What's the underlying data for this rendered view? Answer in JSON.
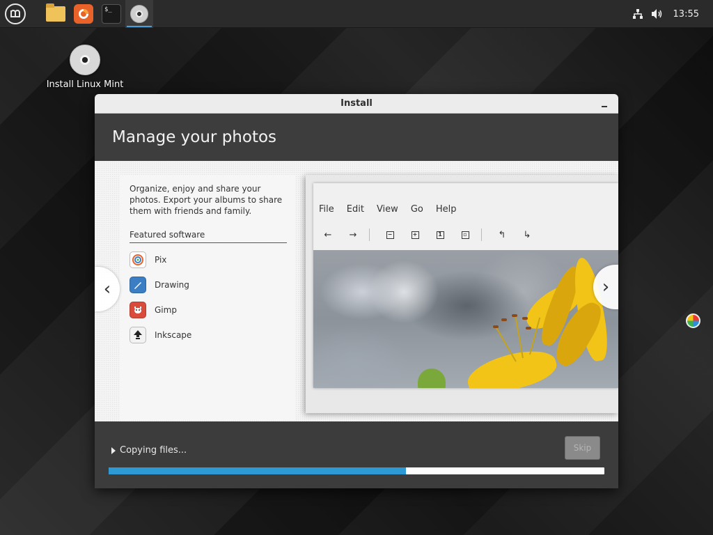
{
  "panel": {
    "launchers": [
      {
        "name": "mint-menu",
        "icon": "mint-logo-icon"
      },
      {
        "name": "files",
        "icon": "folder-icon"
      },
      {
        "name": "firefox",
        "icon": "firefox-icon"
      },
      {
        "name": "terminal",
        "icon": "terminal-icon",
        "glyph": "$_"
      },
      {
        "name": "installer",
        "icon": "disc-icon",
        "active": true
      }
    ],
    "tray": {
      "network_icon": "network-icon",
      "volume_icon": "volume-icon",
      "clock": "13:55"
    }
  },
  "desktop": {
    "icons": [
      {
        "label": "Install Linux Mint",
        "icon": "disc-icon"
      }
    ]
  },
  "window": {
    "title": "Install",
    "slide_title": "Manage your photos",
    "description": "Organize, enjoy and share your photos. Export your albums to share them with friends and family.",
    "featured_label": "Featured software",
    "apps": [
      {
        "label": "Pix",
        "icon": "pix-icon",
        "color": "#e9e4f2"
      },
      {
        "label": "Drawing",
        "icon": "drawing-icon",
        "color": "#3b7ec4"
      },
      {
        "label": "Gimp",
        "icon": "gimp-icon",
        "color": "#d94b3b"
      },
      {
        "label": "Inkscape",
        "icon": "inkscape-icon",
        "color": "#f2f2f2"
      }
    ],
    "screenshot": {
      "menu": [
        "File",
        "Edit",
        "View",
        "Go",
        "Help"
      ]
    },
    "status_text": "Copying files...",
    "skip_label": "Skip",
    "progress": 0.6
  },
  "colors": {
    "accent": "#2d9ad6",
    "panel_bg": "#2b2b2b",
    "window_bg": "#3c3c3c"
  }
}
